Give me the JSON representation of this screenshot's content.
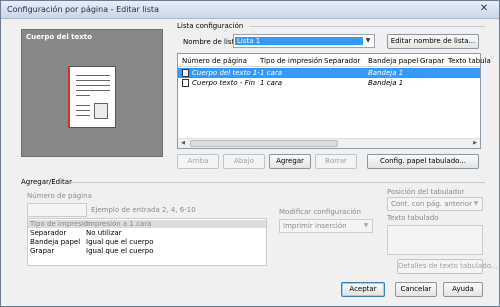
{
  "window": {
    "title": "Configuración por página - Editar lista"
  },
  "preview": {
    "label": "Cuerpo del texto"
  },
  "list_config": {
    "group_label": "Lista configuración",
    "list_name_label": "Nombre de lista",
    "list_name_value": "Lista 1",
    "edit_name_button": "Editar nombre de lista...",
    "columns": [
      "Número de página",
      "Tipo de impresión",
      "Separador",
      "Bandeja papel",
      "Grapar",
      "Texto tabula"
    ],
    "rows": [
      {
        "page": "Cuerpo del texto 1-",
        "print_type": "1 cara",
        "separator": "",
        "tray": "Bandeja 1",
        "staple": "",
        "tab_text": ""
      },
      {
        "page": "Cuerpo texto - Fin",
        "print_type": "1 cara",
        "separator": "",
        "tray": "Bandeja 1",
        "staple": "",
        "tab_text": ""
      }
    ],
    "buttons": {
      "up": "Arriba",
      "down": "Abajo",
      "add": "Agregar",
      "delete": "Borrar",
      "tab_paper": "Config. papel tabulado..."
    }
  },
  "add_edit": {
    "group_label": "Agregar/Editar",
    "page_number_label": "Número de página",
    "page_number_value": "",
    "example_text": "Ejemplo de entrada 2, 4, 6-10",
    "properties": [
      {
        "name": "Tipo de impresión",
        "value": "Impresión a 1 cara"
      },
      {
        "name": "Separador",
        "value": "No utilizar"
      },
      {
        "name": "Bandeja papel",
        "value": "Igual que el cuerpo"
      },
      {
        "name": "Grapar",
        "value": "Igual que el cuerpo"
      }
    ],
    "modify_label": "Modificar configuración",
    "modify_value": "Imprimir inserción",
    "tab_position_label": "Posición del tabulador",
    "tab_position_value": "Cont. con pág. anterior",
    "tab_text_label": "Texto tabulado",
    "tab_text_details_button": "Detalles de texto tabulado..."
  },
  "footer": {
    "accept": "Aceptar",
    "cancel": "Cancelar",
    "help": "Ayuda"
  },
  "icons": [
    "close-icon",
    "dropdown-arrow-icon",
    "document-icon"
  ]
}
